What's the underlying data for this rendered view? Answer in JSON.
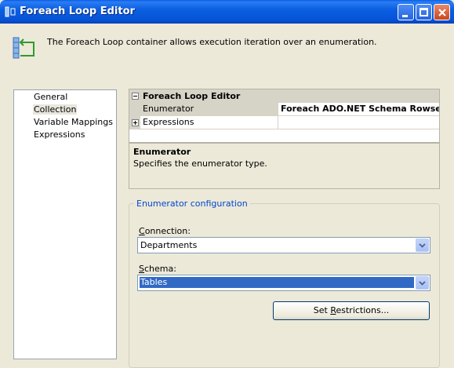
{
  "window": {
    "title": "Foreach Loop Editor"
  },
  "header": {
    "description": "The Foreach Loop container allows execution iteration over an enumeration."
  },
  "nav": {
    "items": [
      {
        "label": "General",
        "selected": false
      },
      {
        "label": "Collection",
        "selected": true
      },
      {
        "label": "Variable Mappings",
        "selected": false
      },
      {
        "label": "Expressions",
        "selected": false
      }
    ]
  },
  "grid": {
    "category": "Foreach Loop Editor",
    "rows": [
      {
        "name": "Enumerator",
        "value": "Foreach ADO.NET Schema Rowset Enumerator"
      },
      {
        "name": "Expressions",
        "value": ""
      }
    ]
  },
  "description": {
    "title": "Enumerator",
    "text": "Specifies the enumerator type."
  },
  "config": {
    "group_title": "Enumerator configuration",
    "connection_label_prefix": "",
    "connection_label_access": "C",
    "connection_label_rest": "onnection:",
    "connection_value": "Departments",
    "schema_label_access": "S",
    "schema_label_rest": "chema:",
    "schema_value": "Tables",
    "button_prefix": "Set ",
    "button_access": "R",
    "button_rest": "estrictions..."
  }
}
